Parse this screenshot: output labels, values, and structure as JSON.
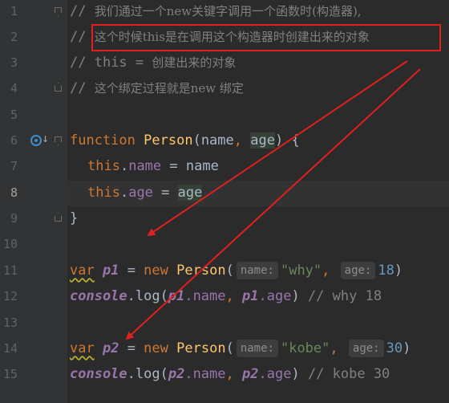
{
  "lines": [
    {
      "n": "1",
      "comment": "我们通过一个new关键字调用一个函数时(构造器),"
    },
    {
      "n": "2",
      "comment": "这个时候this是在调用这个构造器时创建出来的对象"
    },
    {
      "n": "3",
      "comment_a": "this = ",
      "comment_b": "创建出来的对象"
    },
    {
      "n": "4",
      "comment": "这个绑定过程就是new 绑定"
    },
    {
      "n": "5"
    },
    {
      "n": "6",
      "kw": "function",
      "fn": "Person",
      "p1": "name",
      "sep": ", ",
      "p2": "age",
      "tail": ") {"
    },
    {
      "n": "7",
      "this": "this",
      "dot": ".",
      "prop": "name",
      "op": " = ",
      "val": "name"
    },
    {
      "n": "8",
      "this": "this",
      "dot": ".",
      "prop": "age",
      "op": " = ",
      "val": "age"
    },
    {
      "n": "9",
      "close": "}"
    },
    {
      "n": "10"
    },
    {
      "n": "11",
      "var": "var",
      "name": "p1",
      "eq": " = ",
      "new": "new",
      "ctor": "Person",
      "h1": "name:",
      "a1": "\"why\"",
      "comma": ",",
      "h2": "age:",
      "a2": "18",
      "end": ")"
    },
    {
      "n": "12",
      "console": "console",
      "log": ".log(",
      "v1": "p1",
      "pa": ".name",
      "c": ", ",
      "v2": "p1",
      "pb": ".age",
      "close": ")",
      "cmt": "// why 18"
    },
    {
      "n": "13"
    },
    {
      "n": "14",
      "var": "var",
      "name": "p2",
      "eq": " = ",
      "new": "new",
      "ctor": "Person",
      "h1": "name:",
      "a1": "\"kobe\"",
      "comma": ",",
      "h2": "age:",
      "a2": "30",
      "end": ")"
    },
    {
      "n": "15",
      "console": "console",
      "log": ".log(",
      "v1": "p2",
      "pa": ".name",
      "c": ", ",
      "v2": "p2",
      "pb": ".age",
      "close": ")",
      "cmt": "// kobe 30"
    }
  ],
  "comment_prefix": "// ",
  "colors": {
    "annotation": "#e0201f",
    "background": "#2b2b2b",
    "keyword": "#cc7832",
    "function": "#ffc66d",
    "string": "#6a8759",
    "number": "#6897bb",
    "property": "#9876aa"
  }
}
